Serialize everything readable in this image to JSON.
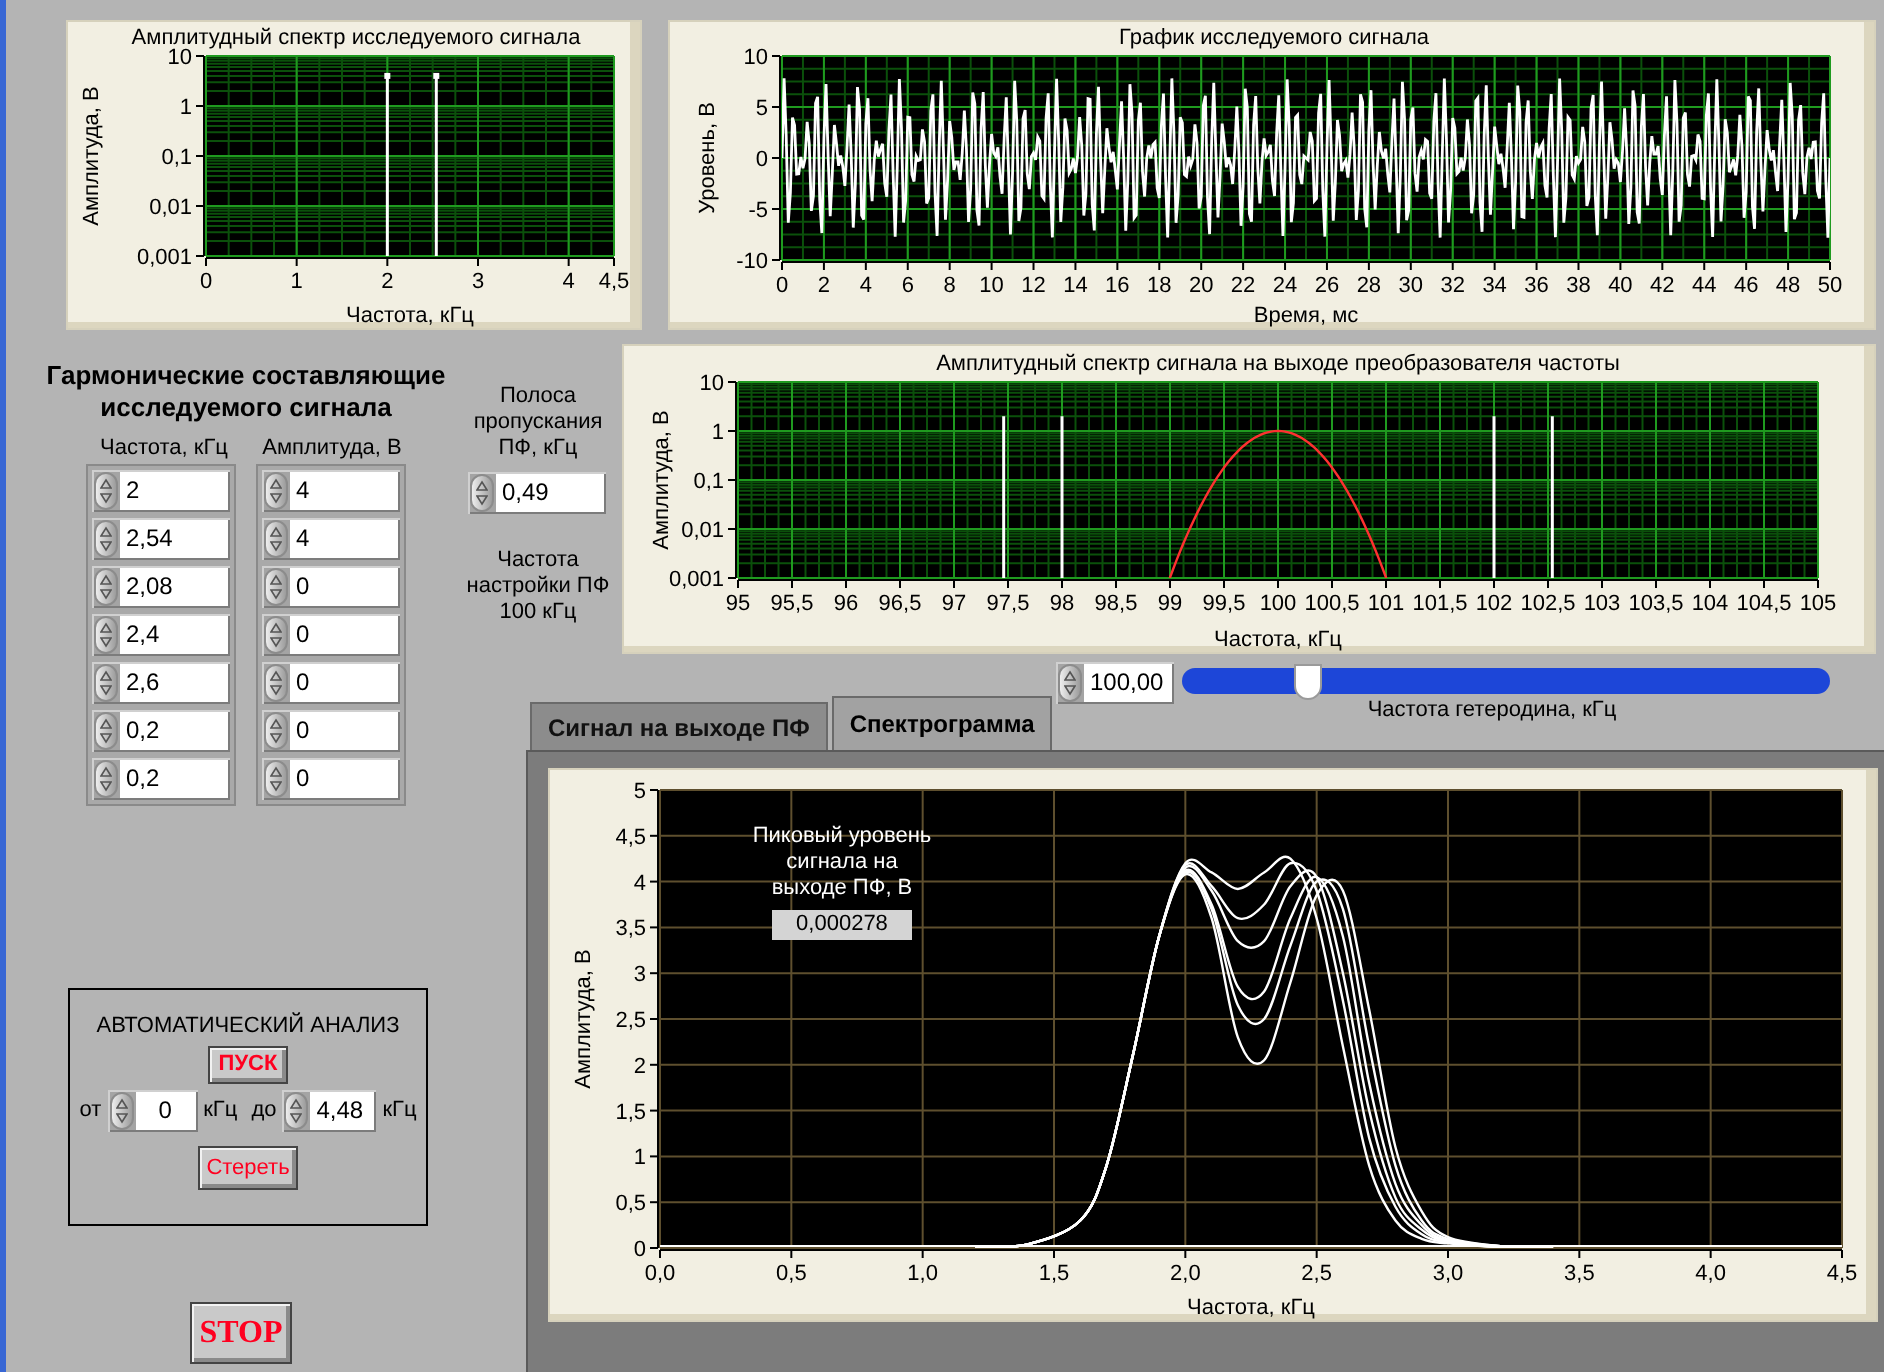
{
  "input_spectrum": {
    "title": "Амплитудный спектр исследуемого сигнала",
    "xlabel": "Частота, кГц",
    "ylabel": "Амплитуда, В",
    "xticks": [
      "0",
      "1",
      "2",
      "3",
      "4",
      "4,5"
    ],
    "yticks": [
      "10",
      "1",
      "0,1",
      "0,01",
      "0,001"
    ]
  },
  "signal_graph": {
    "title": "График  исследуемого сигнала",
    "xlabel": "Время, мс",
    "ylabel": "Уровень, В",
    "xticks": [
      "0",
      "2",
      "4",
      "6",
      "8",
      "10",
      "12",
      "14",
      "16",
      "18",
      "20",
      "22",
      "24",
      "26",
      "28",
      "30",
      "32",
      "34",
      "36",
      "38",
      "40",
      "42",
      "44",
      "46",
      "48",
      "50"
    ],
    "yticks": [
      "10",
      "5",
      "0",
      "-5",
      "-10"
    ]
  },
  "harmonics": {
    "title": "Гармонические составляющие исследуемого сигнала",
    "frequency_label": "Частота, кГц",
    "amplitude_label": "Амплитуда, В",
    "rows": [
      {
        "frequency": "2",
        "amplitude": "4"
      },
      {
        "frequency": "2,54",
        "amplitude": "4"
      },
      {
        "frequency": "2,08",
        "amplitude": "0"
      },
      {
        "frequency": "2,4",
        "amplitude": "0"
      },
      {
        "frequency": "2,6",
        "amplitude": "0"
      },
      {
        "frequency": "0,2",
        "amplitude": "0"
      },
      {
        "frequency": "0,2",
        "amplitude": "0"
      }
    ]
  },
  "bandpass": {
    "label": "Полоса пропускания ПФ, кГц",
    "value": "0,49"
  },
  "filter_tuning": {
    "text": "Частота настройки ПФ 100 кГц"
  },
  "output_spectrum": {
    "title": "Амплитудный спектр сигнала на выходе преобразователя частоты",
    "xlabel": "Частота, кГц",
    "ylabel": "Амплитуда, В",
    "xticks": [
      "95",
      "95,5",
      "96",
      "96,5",
      "97",
      "97,5",
      "98",
      "98,5",
      "99",
      "99,5",
      "100",
      "100,5",
      "101",
      "101,5",
      "102",
      "102,5",
      "103",
      "103,5",
      "104",
      "104,5",
      "105"
    ],
    "yticks": [
      "10",
      "1",
      "0,1",
      "0,01",
      "0,001"
    ]
  },
  "heterodyne": {
    "value": "100,00",
    "level": 0.18,
    "label": "Частота гетеродина, кГц"
  },
  "tabs": [
    {
      "label": "Сигнал на выходе ПФ",
      "selected": false
    },
    {
      "label": "Спектрограмма",
      "selected": true
    }
  ],
  "spectrogram": {
    "chart_data": {
      "type": "line",
      "xlabel": "Частота, кГц",
      "ylabel": "Амплитуда, В",
      "grid": true,
      "x": [
        1.2,
        1.4,
        1.6,
        1.7,
        1.8,
        1.9,
        2.0,
        2.1,
        2.2,
        2.3,
        2.4,
        2.5,
        2.6,
        2.7,
        2.8,
        2.9,
        3.0,
        3.2,
        3.4
      ],
      "series": [
        {
          "color": "#ffffff",
          "values": [
            0.01,
            0.04,
            0.3,
            0.9,
            2.1,
            3.4,
            4.2,
            4.1,
            3.92,
            4.1,
            4.25,
            3.6,
            2.2,
            0.9,
            0.3,
            0.1,
            0.05,
            0.01,
            0
          ]
        },
        {
          "color": "#ffffff",
          "values": [
            0.01,
            0.04,
            0.3,
            0.9,
            2.1,
            3.4,
            4.18,
            3.95,
            3.6,
            3.75,
            4.2,
            3.9,
            2.7,
            1.2,
            0.45,
            0.15,
            0.06,
            0.01,
            0
          ]
        },
        {
          "color": "#ffffff",
          "values": [
            0.01,
            0.04,
            0.3,
            0.9,
            2.1,
            3.4,
            4.15,
            3.9,
            3.35,
            3.35,
            3.95,
            4.05,
            3.0,
            1.5,
            0.55,
            0.2,
            0.07,
            0.01,
            0
          ]
        },
        {
          "color": "#ffffff",
          "values": [
            0.01,
            0.04,
            0.3,
            0.9,
            2.1,
            3.4,
            4.12,
            3.75,
            2.85,
            2.8,
            3.6,
            4.05,
            3.4,
            1.8,
            0.7,
            0.25,
            0.08,
            0.02,
            0
          ]
        },
        {
          "color": "#ffffff",
          "values": [
            0.01,
            0.04,
            0.3,
            0.9,
            2.1,
            3.4,
            4.1,
            3.7,
            2.65,
            2.5,
            3.3,
            4.0,
            3.7,
            2.2,
            0.9,
            0.3,
            0.1,
            0.02,
            0
          ]
        },
        {
          "color": "#ffffff",
          "values": [
            0.01,
            0.04,
            0.3,
            0.9,
            2.1,
            3.4,
            4.08,
            3.6,
            2.3,
            2.05,
            2.9,
            3.85,
            3.9,
            2.6,
            1.1,
            0.4,
            0.12,
            0.02,
            0
          ]
        }
      ],
      "xlim": [
        0,
        4.5
      ],
      "ylim": [
        0,
        5
      ],
      "xticks": [
        {
          "value": 0,
          "label": "0,0"
        },
        {
          "value": 0.5,
          "label": "0,5"
        },
        {
          "value": 1,
          "label": "1,0"
        },
        {
          "value": 1.5,
          "label": "1,5"
        },
        {
          "value": 2,
          "label": "2,0"
        },
        {
          "value": 2.5,
          "label": "2,5"
        },
        {
          "value": 3,
          "label": "3,0"
        },
        {
          "value": 3.5,
          "label": "3,5"
        },
        {
          "value": 4,
          "label": "4,0"
        },
        {
          "value": 4.5,
          "label": "4,5"
        }
      ],
      "yticks": [
        0,
        {
          "value": 0.5,
          "label": "0,5"
        },
        1,
        {
          "value": 1.5,
          "label": "1,5"
        },
        2,
        {
          "value": 2.5,
          "label": "2,5"
        },
        3,
        {
          "value": 3.5,
          "label": "3,5"
        },
        4,
        {
          "value": 4.5,
          "label": "4,5"
        },
        5
      ]
    },
    "peak_label": "Пиковый уровень сигнала на выходе ПФ, В",
    "peak_value": "0,000278"
  },
  "auto_analysis": {
    "title": "АВТОМАТИЧЕСКИЙ АНАЛИЗ",
    "start_button": "ПУСК",
    "from_label": "от",
    "from_value": "0",
    "from_unit": "кГц",
    "to_label": "до",
    "to_value": "4,48",
    "to_unit": "кГц",
    "clear_button": "Стереть"
  },
  "stop_button": "STOP"
}
